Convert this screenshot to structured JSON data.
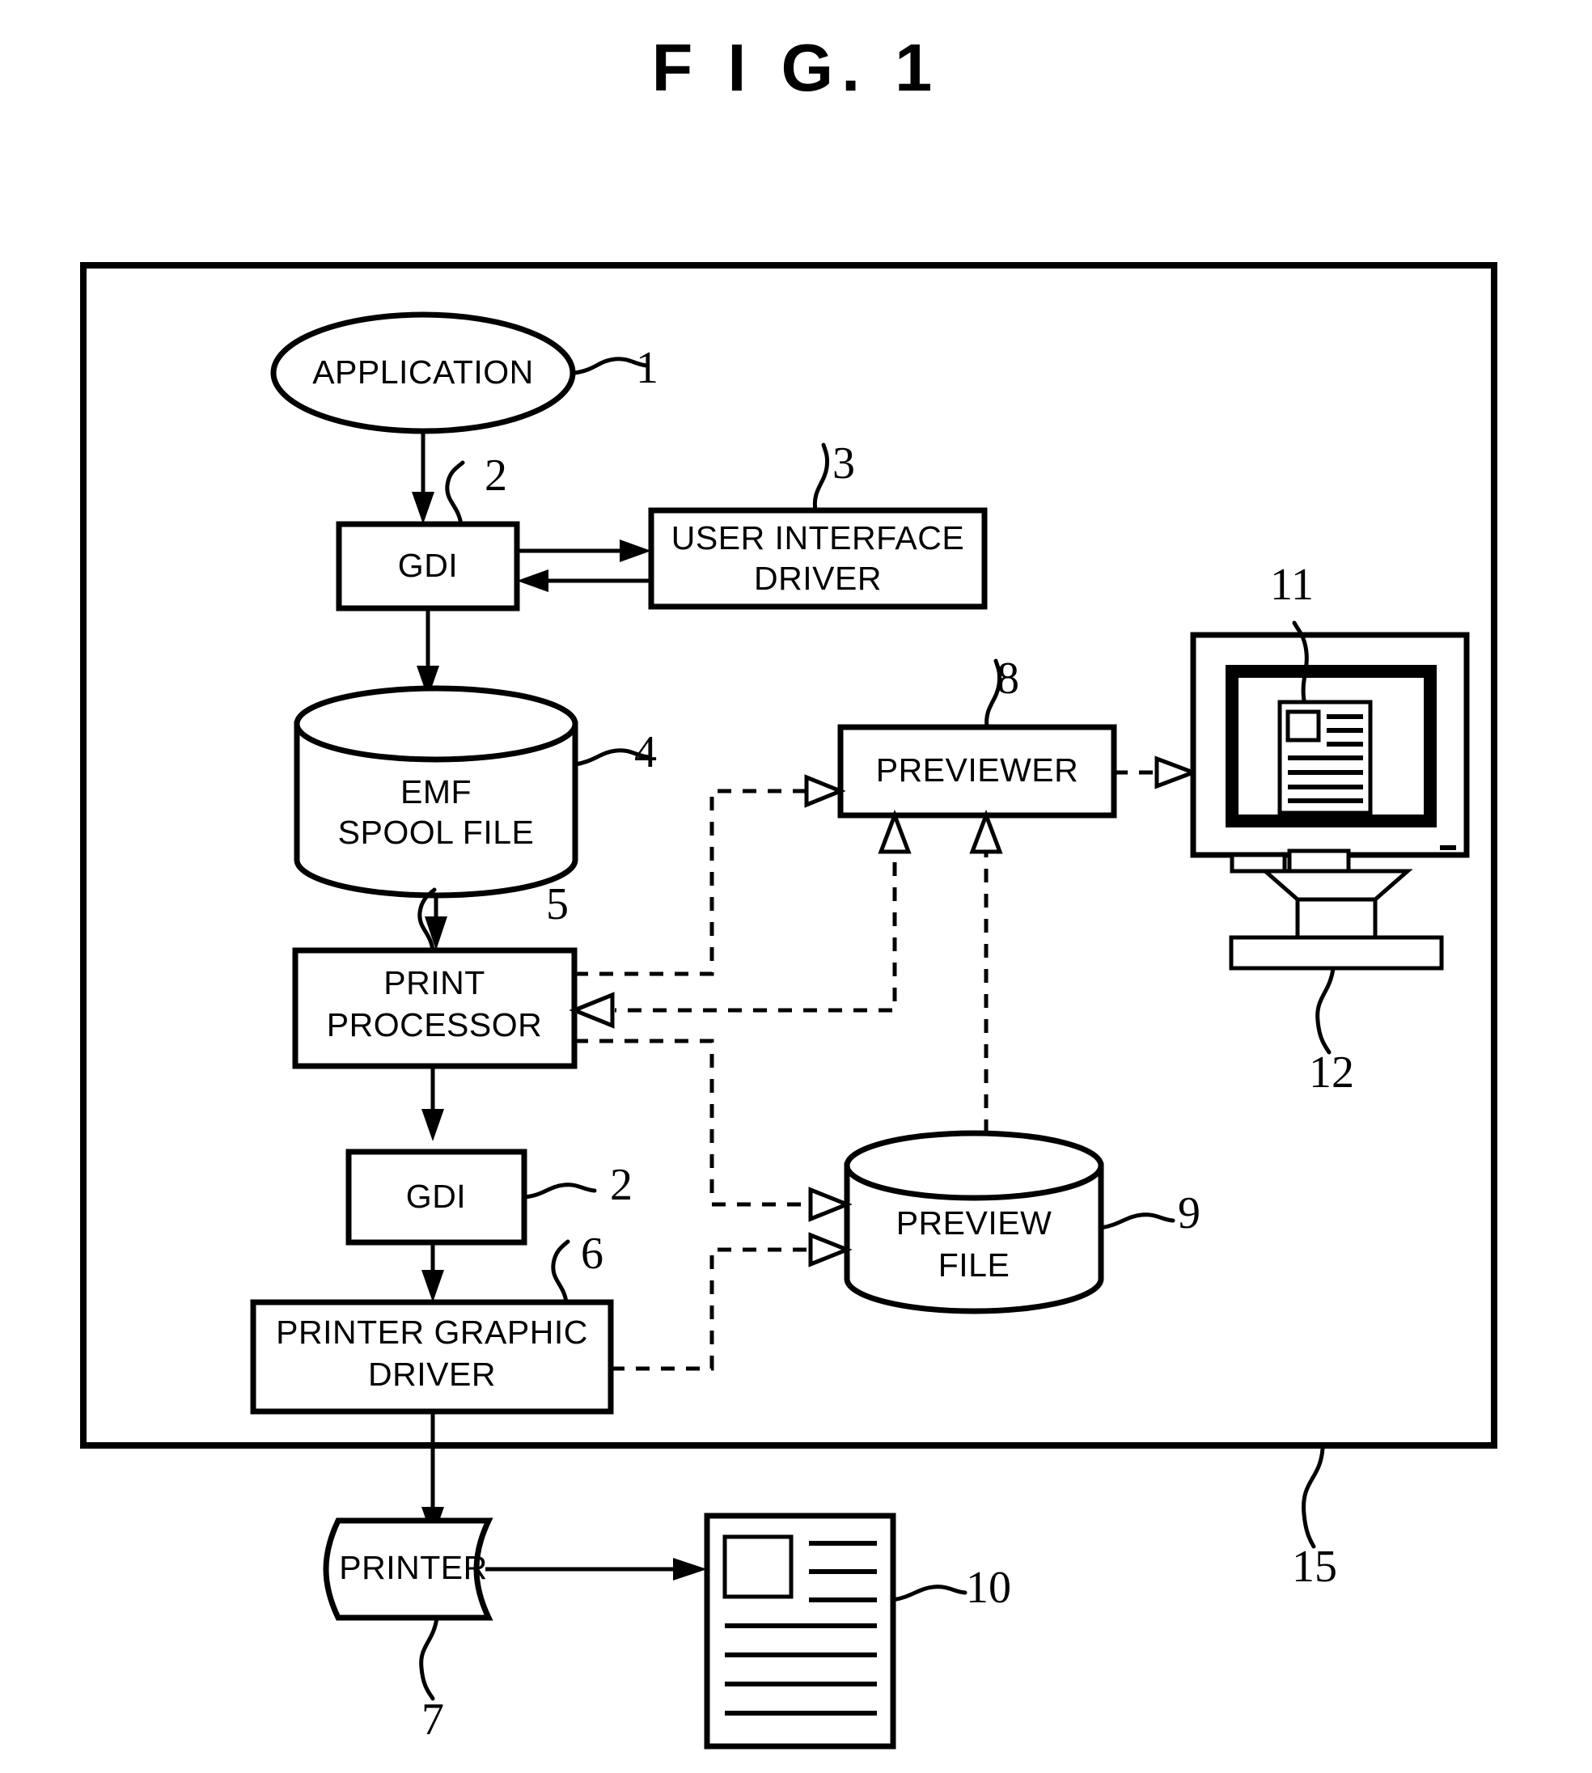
{
  "figure": {
    "title": "F I G.  1",
    "title_plain": "FIG. 1"
  },
  "nodes": {
    "application": {
      "label": "APPLICATION",
      "ref": "1",
      "shape": "ellipse"
    },
    "gdi_top": {
      "label": "GDI",
      "ref": "2",
      "shape": "rect"
    },
    "ui_driver": {
      "label_line1": "USER INTERFACE",
      "label_line2": "DRIVER",
      "ref": "3",
      "shape": "rect"
    },
    "emf_spool": {
      "label_line1": "EMF",
      "label_line2": "SPOOL FILE",
      "ref": "4",
      "shape": "cylinder"
    },
    "print_processor": {
      "label_line1": "PRINT",
      "label_line2": "PROCESSOR",
      "ref": "5",
      "shape": "rect"
    },
    "gdi_bottom": {
      "label": "GDI",
      "ref": "2",
      "shape": "rect"
    },
    "printer_graphic_driver": {
      "label_line1": "PRINTER GRAPHIC",
      "label_line2": "DRIVER",
      "ref": "6",
      "shape": "rect"
    },
    "printer": {
      "label": "PRINTER",
      "ref": "7",
      "shape": "document"
    },
    "previewer": {
      "label": "PREVIEWER",
      "ref": "8",
      "shape": "rect"
    },
    "preview_file": {
      "label_line1": "PREVIEW",
      "label_line2": "FILE",
      "ref": "9",
      "shape": "cylinder"
    },
    "printed_document": {
      "label": "",
      "ref": "10",
      "shape": "page"
    },
    "preview_image": {
      "label": "",
      "ref": "11",
      "shape": "page-on-screen"
    },
    "monitor_stand": {
      "label": "",
      "ref": "12",
      "shape": "stand"
    },
    "system_frame": {
      "label": "",
      "ref": "15",
      "shape": "frame"
    }
  },
  "ref_numbers": [
    "1",
    "2",
    "3",
    "4",
    "5",
    "2",
    "6",
    "7",
    "8",
    "9",
    "10",
    "11",
    "12",
    "15"
  ],
  "colors": {
    "stroke": "#000000",
    "fill": "#ffffff",
    "background": "#ffffff"
  }
}
